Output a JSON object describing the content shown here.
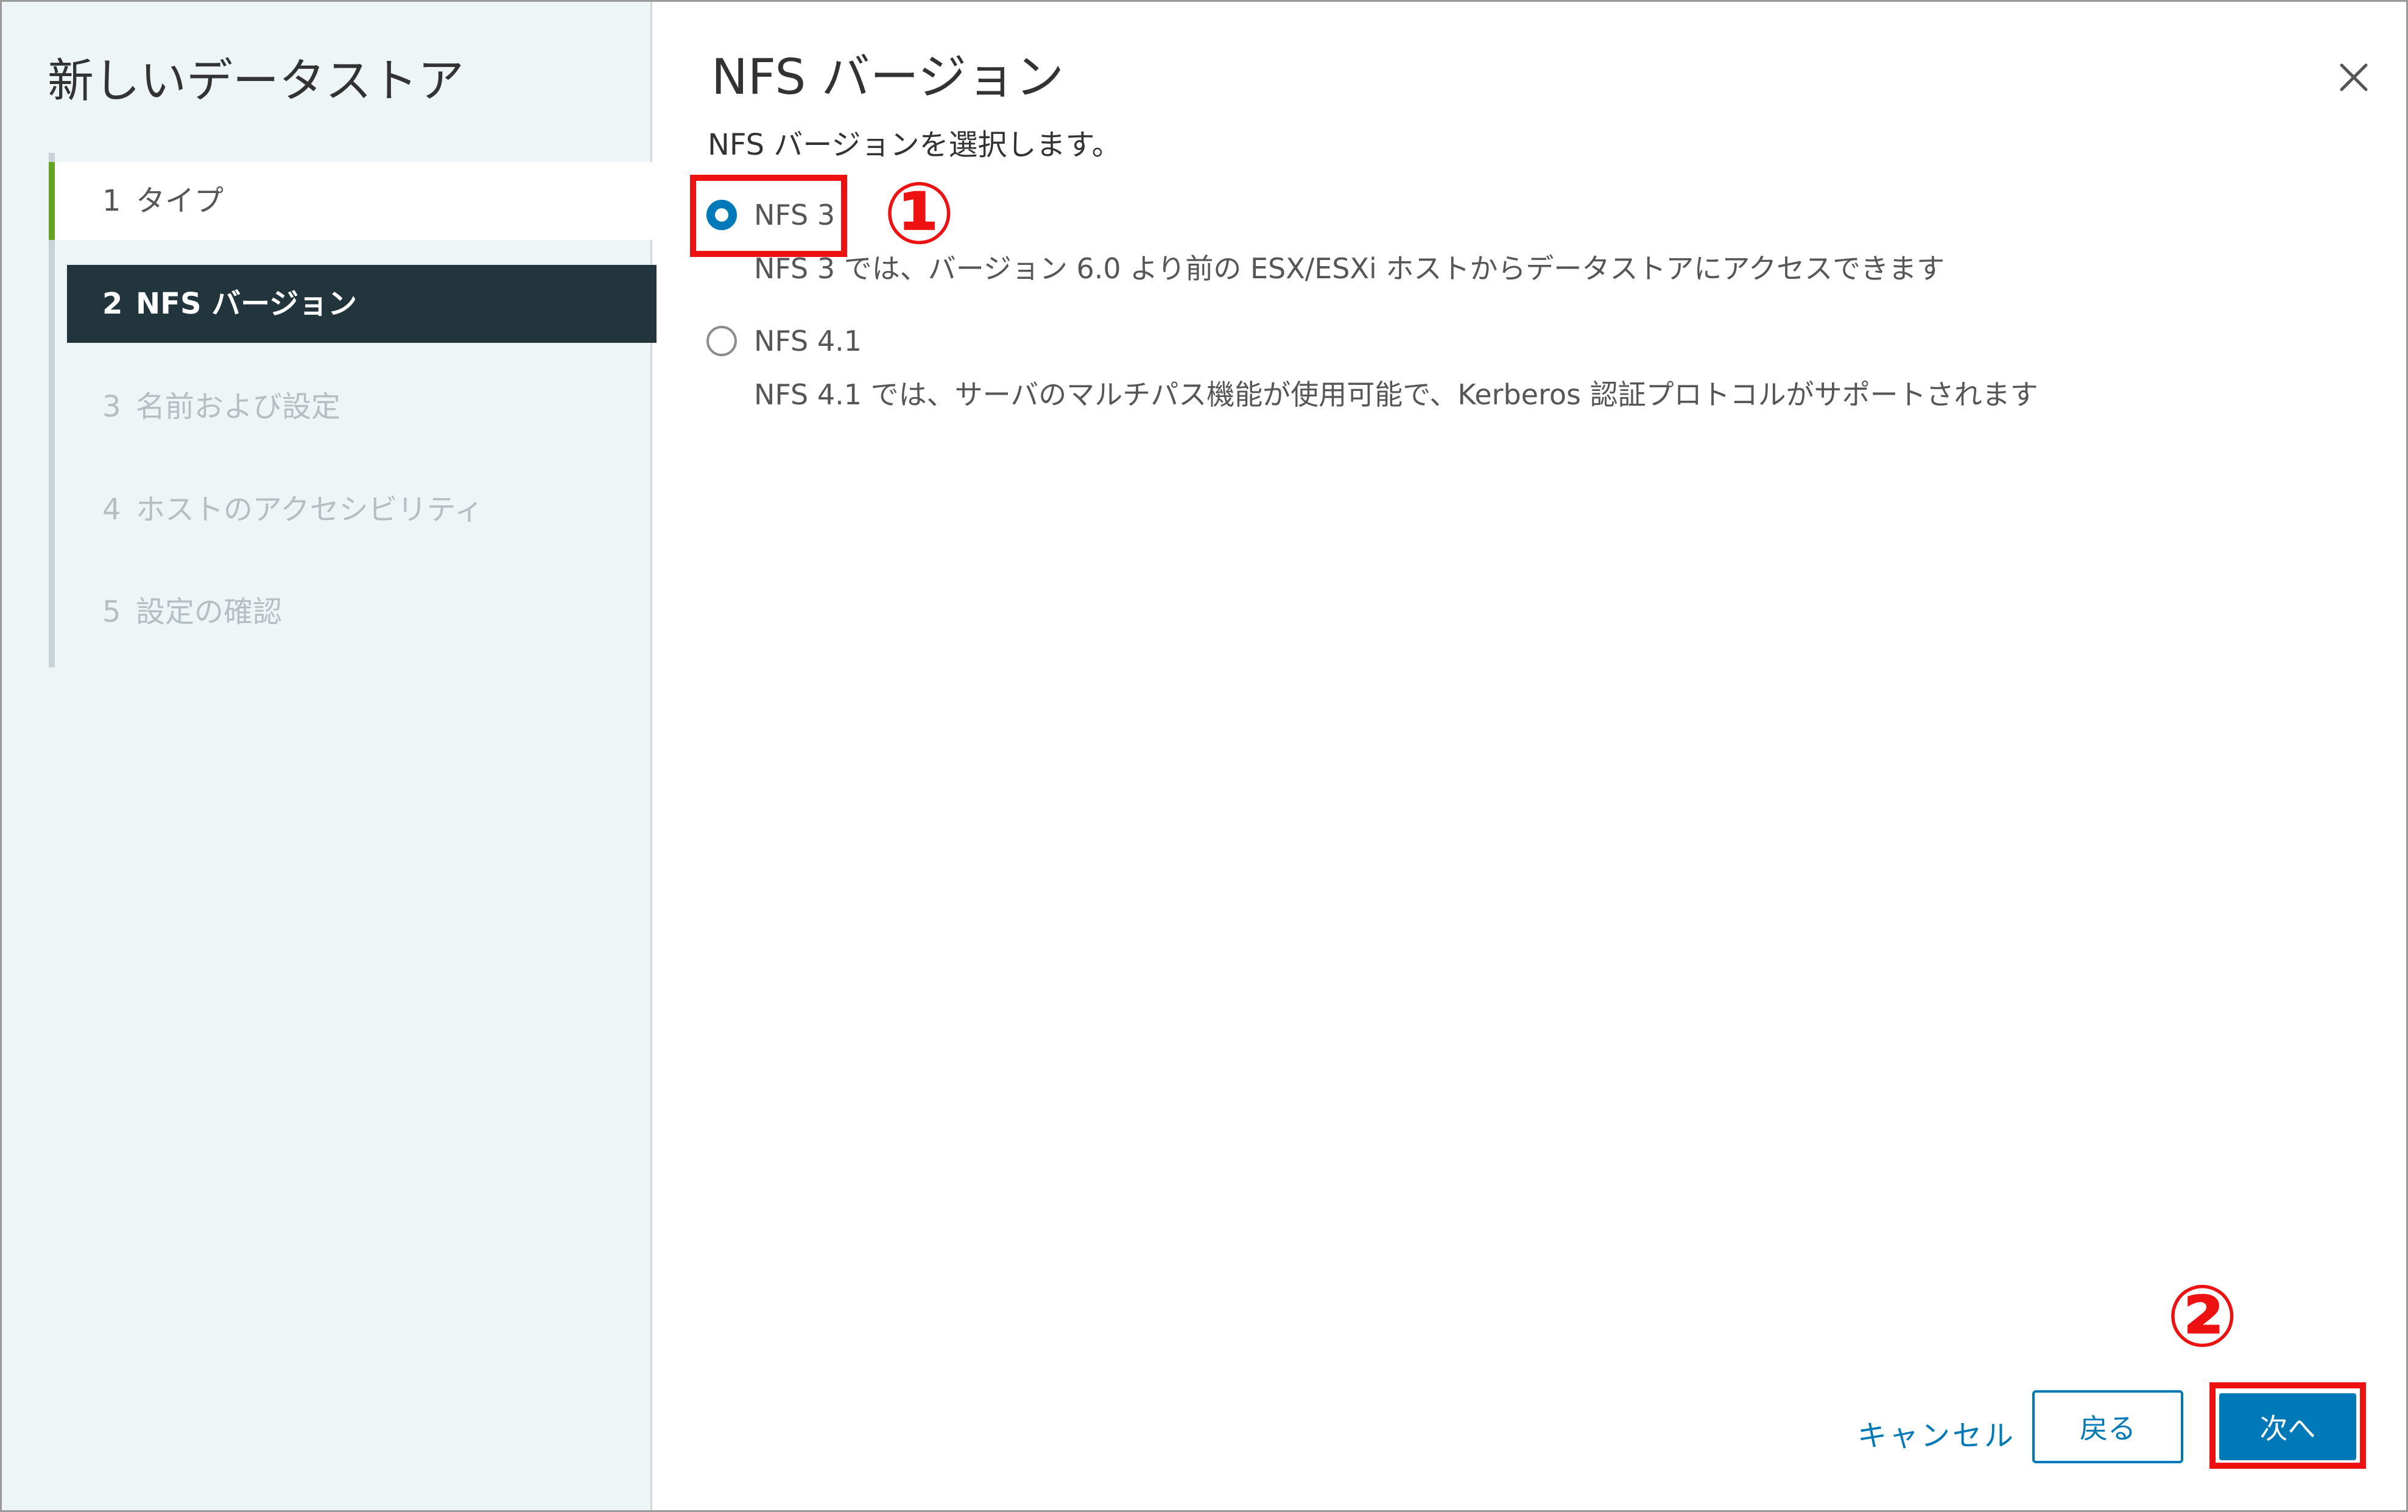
{
  "wizard": {
    "title": "新しいデータストア",
    "steps": [
      {
        "num": "1",
        "label": "タイプ",
        "state": "done"
      },
      {
        "num": "2",
        "label": "NFS バージョン",
        "state": "active"
      },
      {
        "num": "3",
        "label": "名前および設定",
        "state": "pending"
      },
      {
        "num": "4",
        "label": "ホストのアクセシビリティ",
        "state": "pending"
      },
      {
        "num": "5",
        "label": "設定の確認",
        "state": "pending"
      }
    ]
  },
  "main": {
    "title": "NFS バージョン",
    "subtitle": "NFS バージョンを選択します。",
    "options": [
      {
        "label": "NFS 3",
        "checked": true,
        "description": "NFS 3 では、バージョン 6.0 より前の ESX/ESXi ホストからデータストアにアクセスできます"
      },
      {
        "label": "NFS 4.1",
        "checked": false,
        "description": "NFS 4.1 では、サーバのマルチパス機能が使用可能で、Kerberos 認証プロトコルがサポートされます"
      }
    ]
  },
  "footer": {
    "cancel_label": "キャンセル",
    "back_label": "戻る",
    "next_label": "次へ"
  },
  "annotations": {
    "marker_1": "①",
    "marker_2": "②"
  },
  "colors": {
    "accent": "#0079b8",
    "sidebar_bg": "#eef5f7",
    "active_step_bg": "#22343c",
    "done_step_marker": "#62a420",
    "annotation_red": "#ee1111"
  },
  "icons": {
    "close": "close-icon"
  }
}
